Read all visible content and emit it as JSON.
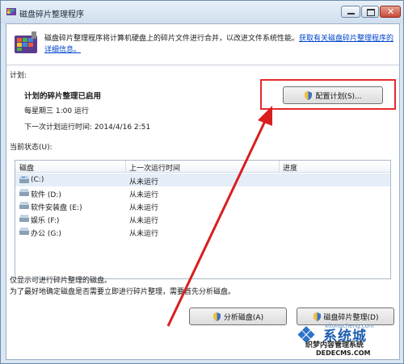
{
  "window": {
    "title": "磁盘碎片整理程序"
  },
  "header": {
    "description": "磁盘碎片整理程序将计算机硬盘上的碎片文件进行合并，以改进文件系统性能。",
    "help_link": "获取有关磁盘碎片整理程序的详细信息。"
  },
  "schedule": {
    "section_label": "计划:",
    "status": "计划的碎片整理已启用",
    "when": "每星期三  1:00 运行",
    "next_run": "下一次计划运行时间: 2014/4/16 2:51",
    "configure_button": "配置计划(S)..."
  },
  "current_status": {
    "section_label": "当前状态(U):",
    "columns": [
      "磁盘",
      "上一次运行时间",
      "进度"
    ],
    "rows": [
      {
        "disk": "(C:)",
        "last_run": "从未运行",
        "progress": ""
      },
      {
        "disk": "软件 (D:)",
        "last_run": "从未运行",
        "progress": ""
      },
      {
        "disk": "软件安装盘 (E:)",
        "last_run": "从未运行",
        "progress": ""
      },
      {
        "disk": "娱乐 (F:)",
        "last_run": "从未运行",
        "progress": ""
      },
      {
        "disk": "办公 (G:)",
        "last_run": "从未运行",
        "progress": ""
      }
    ]
  },
  "notes": {
    "line1": "仅显示可进行碎片整理的磁盘。",
    "line2": "为了最好地确定磁盘是否需要立即进行碎片整理，需要首先分析磁盘。"
  },
  "buttons": {
    "analyze": "分析磁盘(A)",
    "defragment": "磁盘碎片整理(D)"
  },
  "watermark": {
    "brand": "系统城",
    "domain_small": "xitongcheng.com",
    "cms": "织梦内容管理系统",
    "url": "DEDECMS.COM"
  },
  "colors": {
    "highlight": "#e32b2b",
    "link": "#0044cc",
    "arrow": "#d91e1e"
  }
}
